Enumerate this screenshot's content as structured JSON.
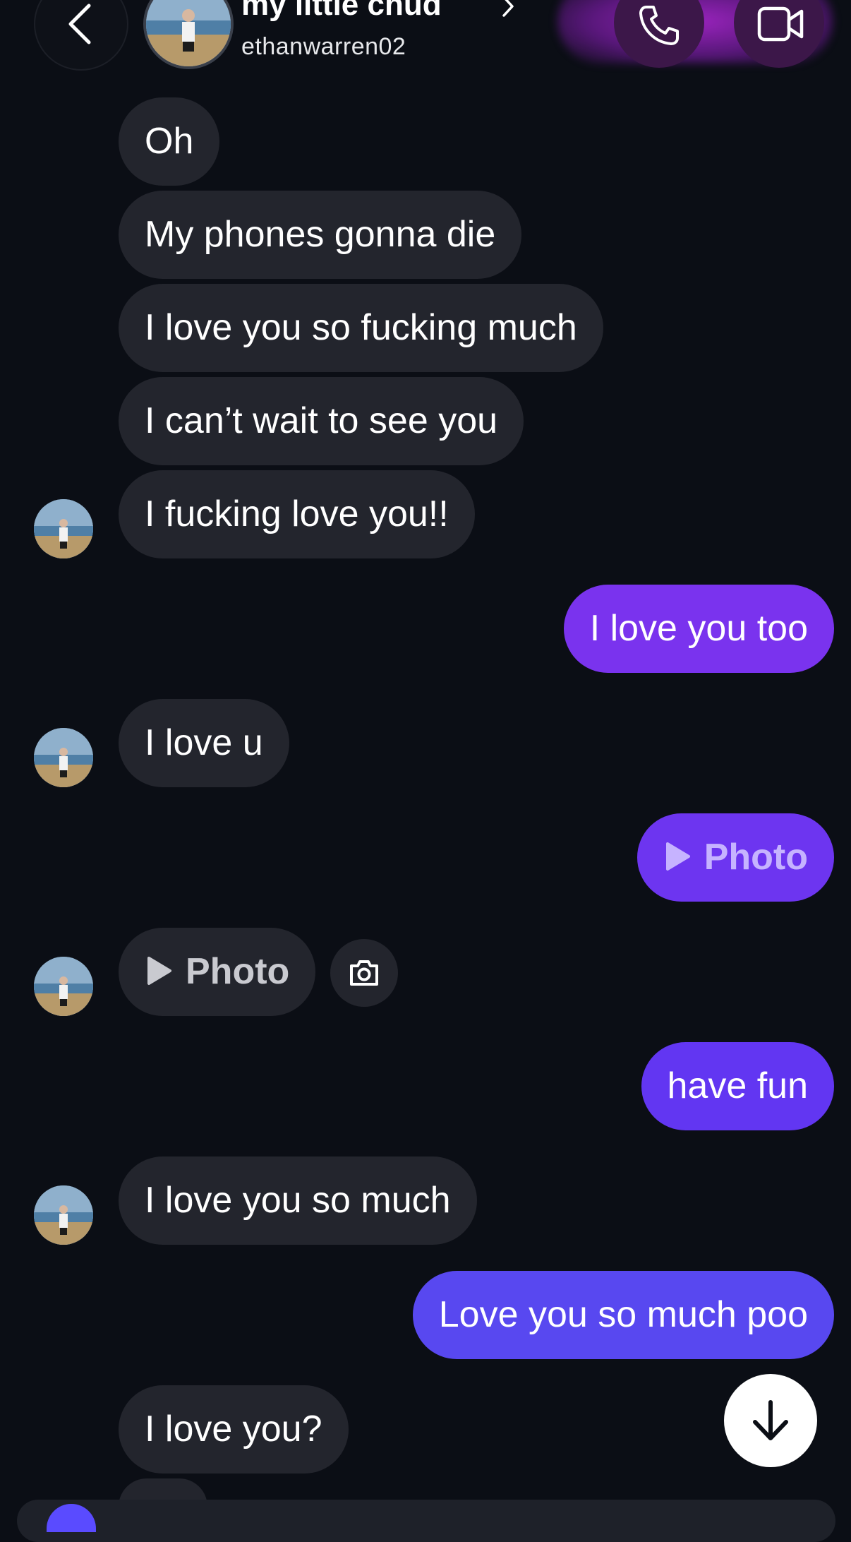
{
  "header": {
    "title": "my little chud",
    "username": "ethanwarren02",
    "back_icon": "chevron-left-icon",
    "call_icon": "phone-icon",
    "video_icon": "video-camera-icon"
  },
  "colors": {
    "background": "#0b0e15",
    "incoming_bubble": "#23252d",
    "outgoing_purple": "#7a33ee",
    "outgoing_violet": "#6236f2",
    "outgoing_indigo": "#5848f0"
  },
  "messages": [
    {
      "from": "them",
      "text": "Oh"
    },
    {
      "from": "them",
      "text": "My phones gonna die"
    },
    {
      "from": "them",
      "text": "I love you so fucking much"
    },
    {
      "from": "them",
      "text": "I can’t wait to see you"
    },
    {
      "from": "them",
      "text": "I fucking love you!!"
    },
    {
      "from": "me",
      "text": "I love you too"
    },
    {
      "from": "them",
      "text": "I love u"
    },
    {
      "from": "me",
      "text": "Photo"
    },
    {
      "from": "them",
      "text": "Photo"
    },
    {
      "from": "me",
      "text": "have fun"
    },
    {
      "from": "them",
      "text": "I love you so much"
    },
    {
      "from": "me",
      "text": "Love you so much poo"
    },
    {
      "from": "them",
      "text": "I love you?"
    }
  ],
  "icons": {
    "camera": "camera-icon",
    "scroll_down": "arrow-down-icon",
    "play": "play-icon"
  }
}
